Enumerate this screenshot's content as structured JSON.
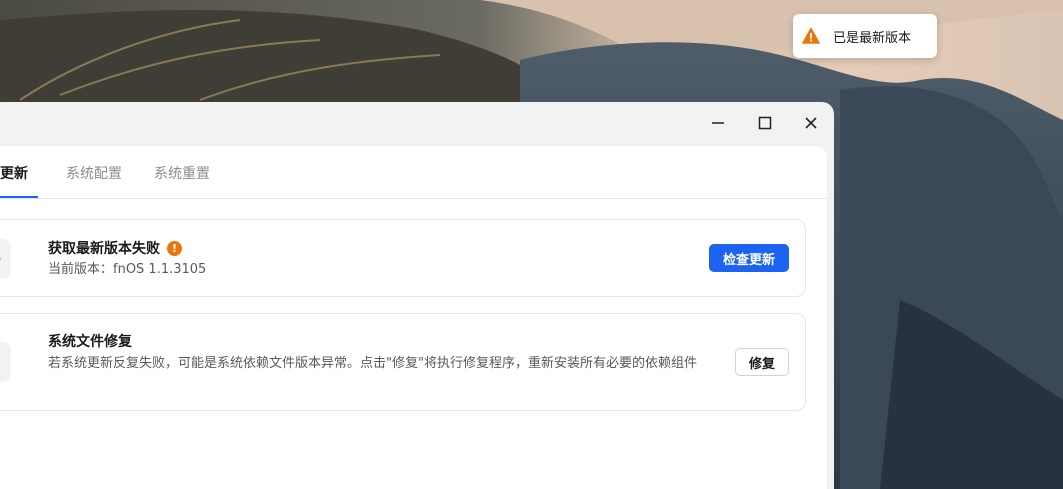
{
  "toast": {
    "icon": "warning-icon",
    "text": "已是最新版本",
    "icon_color": "#e8780e"
  },
  "window": {
    "controls": [
      "minimize-icon",
      "maximize-icon",
      "close-icon"
    ],
    "tabs": [
      {
        "label": "统更新",
        "active": true
      },
      {
        "label": "系统配置",
        "active": false
      },
      {
        "label": "系统重置",
        "active": false
      }
    ]
  },
  "cards": {
    "update": {
      "icon": "upload-arrow-icon",
      "title": "获取最新版本失败",
      "status_icon": "warning-dot-icon",
      "status_glyph": "!",
      "version_text": "当前版本：fnOS 1.1.3105",
      "button": "检查更新"
    },
    "repair": {
      "icon": "wrench-icon",
      "title": "系统文件修复",
      "description": "若系统更新反复失败，可能是系统依赖文件版本异常。点击\"修复\"将执行修复程序，重新安装所有必要的依赖组件",
      "button": "修复"
    }
  },
  "colors": {
    "accent": "#1b63f0",
    "warning": "#e8780e"
  }
}
